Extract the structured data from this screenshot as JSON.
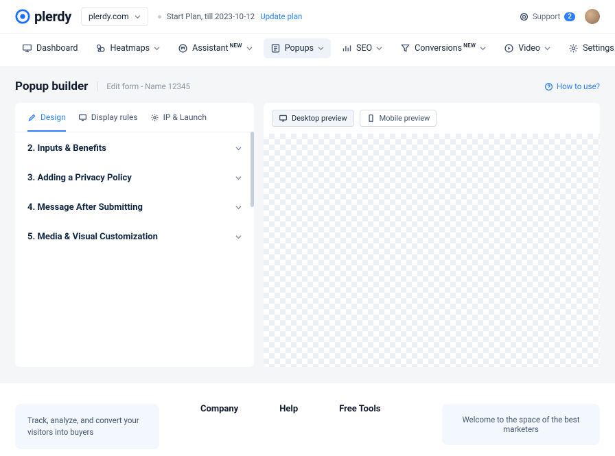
{
  "header": {
    "brand": "plerdy",
    "site_selector": "plerdy.com",
    "plan_text": "Start Plan, till 2023-10-12",
    "update_plan": "Update plan",
    "support_label": "Support",
    "support_count": "2"
  },
  "nav": {
    "dashboard": "Dashboard",
    "heatmaps": "Heatmaps",
    "assistant": "Assistant",
    "assistant_tag": "NEW",
    "popups": "Popups",
    "seo": "SEO",
    "conversions": "Conversions",
    "conversions_tag": "NEW",
    "video": "Video",
    "settings": "Settings"
  },
  "page": {
    "title": "Popup builder",
    "subtitle": "Edit form - Name 12345",
    "how_to_use": "How to use?"
  },
  "tabs": {
    "design": "Design",
    "display_rules": "Display rules",
    "ip_launch": "IP & Launch"
  },
  "accordion": [
    "2. Inputs & Benefits",
    "3. Adding a Privacy Policy",
    "4. Message After Submitting",
    "5. Media & Visual Customization"
  ],
  "preview": {
    "desktop": "Desktop preview",
    "mobile": "Mobile preview"
  },
  "footer": {
    "tagline": "Track, analyze, and convert your visitors into buyers",
    "col_company": "Company",
    "col_help": "Help",
    "col_free_tools": "Free Tools",
    "welcome": "Welcome to the space of the best marketers"
  }
}
